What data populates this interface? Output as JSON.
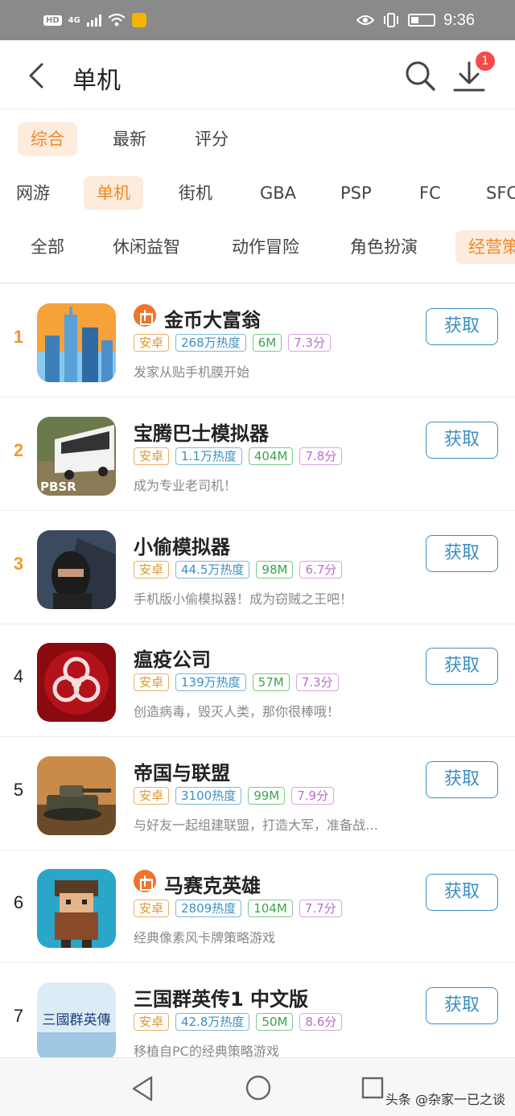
{
  "status_bar": {
    "hd": "HD",
    "network": "4G",
    "time": "9:36",
    "icons": [
      "signal-icon",
      "wifi-icon",
      "eye-icon",
      "vibrate-icon",
      "battery-icon"
    ]
  },
  "header": {
    "title": "单机",
    "download_badge": "1",
    "icons": [
      "back-icon",
      "search-icon",
      "download-icon"
    ]
  },
  "sort_tabs": [
    {
      "label": "综合",
      "active": true
    },
    {
      "label": "最新",
      "active": false
    },
    {
      "label": "评分",
      "active": false
    }
  ],
  "platform_tabs": [
    {
      "label": "网游",
      "active": false
    },
    {
      "label": "单机",
      "active": true
    },
    {
      "label": "街机",
      "active": false
    },
    {
      "label": "GBA",
      "active": false
    },
    {
      "label": "PSP",
      "active": false
    },
    {
      "label": "FC",
      "active": false
    },
    {
      "label": "SFC",
      "active": false
    }
  ],
  "genre_tabs": [
    {
      "label": "全部",
      "active": false
    },
    {
      "label": "休闲益智",
      "active": false
    },
    {
      "label": "动作冒险",
      "active": false
    },
    {
      "label": "角色扮演",
      "active": false
    },
    {
      "label": "经营策",
      "active": true
    }
  ],
  "games": [
    {
      "rank": "1",
      "name": "金币大富翁",
      "gift": true,
      "os": "安卓",
      "heat": "268万热度",
      "size": "6M",
      "score": "7.3分",
      "desc": "发家从贴手机膜开始",
      "button": "获取",
      "icon": "city-buildings-icon"
    },
    {
      "rank": "2",
      "name": "宝腾巴士模拟器",
      "gift": false,
      "os": "安卓",
      "heat": "1.1万热度",
      "size": "404M",
      "score": "7.8分",
      "desc": "成为专业老司机！",
      "button": "获取",
      "icon": "bus-icon",
      "icon_text": "PBSR"
    },
    {
      "rank": "3",
      "name": "小偷模拟器",
      "gift": false,
      "os": "安卓",
      "heat": "44.5万热度",
      "size": "98M",
      "score": "6.7分",
      "desc": "手机版小偷模拟器！成为窃贼之王吧！",
      "button": "获取",
      "icon": "masked-thief-icon"
    },
    {
      "rank": "4",
      "name": "瘟疫公司",
      "gift": false,
      "os": "安卓",
      "heat": "139万热度",
      "size": "57M",
      "score": "7.3分",
      "desc": "创造病毒，毁灭人类，那你很棒哦！",
      "button": "获取",
      "icon": "biohazard-icon"
    },
    {
      "rank": "5",
      "name": "帝国与联盟",
      "gift": false,
      "os": "安卓",
      "heat": "3100热度",
      "size": "99M",
      "score": "7.9分",
      "desc": "与好友一起组建联盟，打造大军，准备战…",
      "button": "获取",
      "icon": "tank-icon"
    },
    {
      "rank": "6",
      "name": "马赛克英雄",
      "gift": true,
      "os": "安卓",
      "heat": "2809热度",
      "size": "104M",
      "score": "7.7分",
      "desc": "经典像素风卡牌策略游戏",
      "button": "获取",
      "icon": "pixel-hero-icon"
    },
    {
      "rank": "7",
      "name": "三国群英传1 中文版",
      "gift": false,
      "os": "安卓",
      "heat": "42.8万热度",
      "size": "50M",
      "score": "8.6分",
      "desc": "移植自PC的经典策略游戏",
      "button": "获取",
      "icon": "calligraphy-title-icon",
      "icon_text": "三國群英傳"
    }
  ],
  "nav_bar": {
    "icons": [
      "nav-back-icon",
      "nav-home-icon",
      "nav-recent-icon"
    ],
    "watermark": "头条 @杂家一已之谈"
  }
}
